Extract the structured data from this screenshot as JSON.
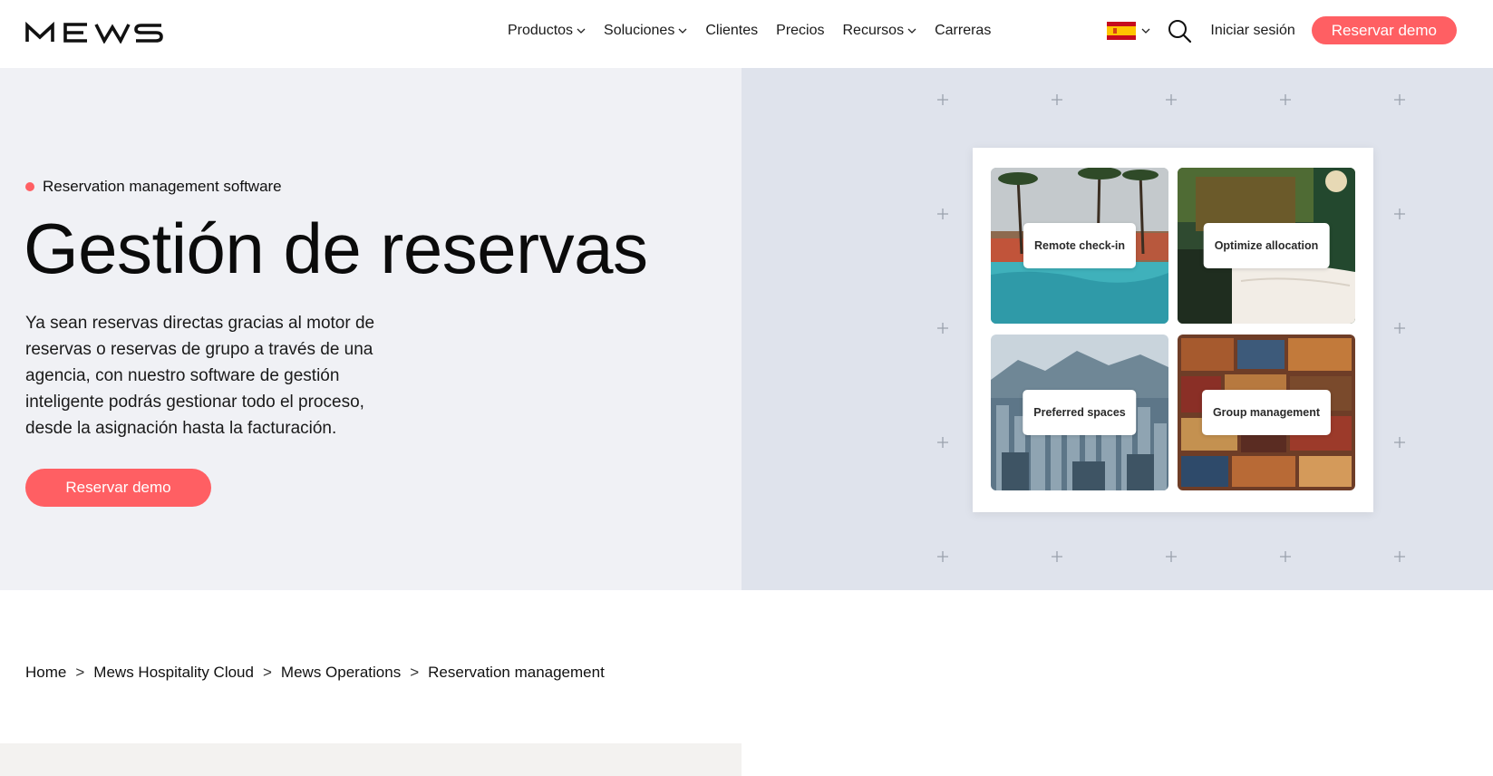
{
  "header": {
    "brand": "MEWS",
    "nav": [
      {
        "label": "Productos",
        "dropdown": true
      },
      {
        "label": "Soluciones",
        "dropdown": true
      },
      {
        "label": "Clientes",
        "dropdown": false
      },
      {
        "label": "Precios",
        "dropdown": false
      },
      {
        "label": "Recursos",
        "dropdown": true
      },
      {
        "label": "Carreras",
        "dropdown": false
      }
    ],
    "language_icon": "spain-flag-icon",
    "search_icon": "search-icon",
    "login_label": "Iniciar sesión",
    "demo_label": "Reservar demo"
  },
  "hero": {
    "eyebrow": "Reservation management software",
    "title": "Gestión de reservas",
    "body": "Ya sean reservas directas gracias al motor de reservas o reservas de grupo a través de una agencia, con nuestro software de gestión inteligente podrás gestionar todo el proceso, desde la asignación hasta la facturación.",
    "cta_label": "Reservar demo"
  },
  "feature_tiles": [
    {
      "label": "Remote check-in",
      "image": "hotel-pool-photo"
    },
    {
      "label": "Optimize allocation",
      "image": "hotel-room-photo"
    },
    {
      "label": "Preferred spaces",
      "image": "city-skyline-photo"
    },
    {
      "label": "Group management",
      "image": "suitcases-photo"
    }
  ],
  "breadcrumb": [
    "Home",
    "Mews Hospitality Cloud",
    "Mews Operations",
    "Reservation management"
  ],
  "colors": {
    "accent": "#ff5f63",
    "hero_left_bg": "#f0f1f5",
    "hero_right_bg": "#dfe3ec",
    "text": "#111111"
  }
}
